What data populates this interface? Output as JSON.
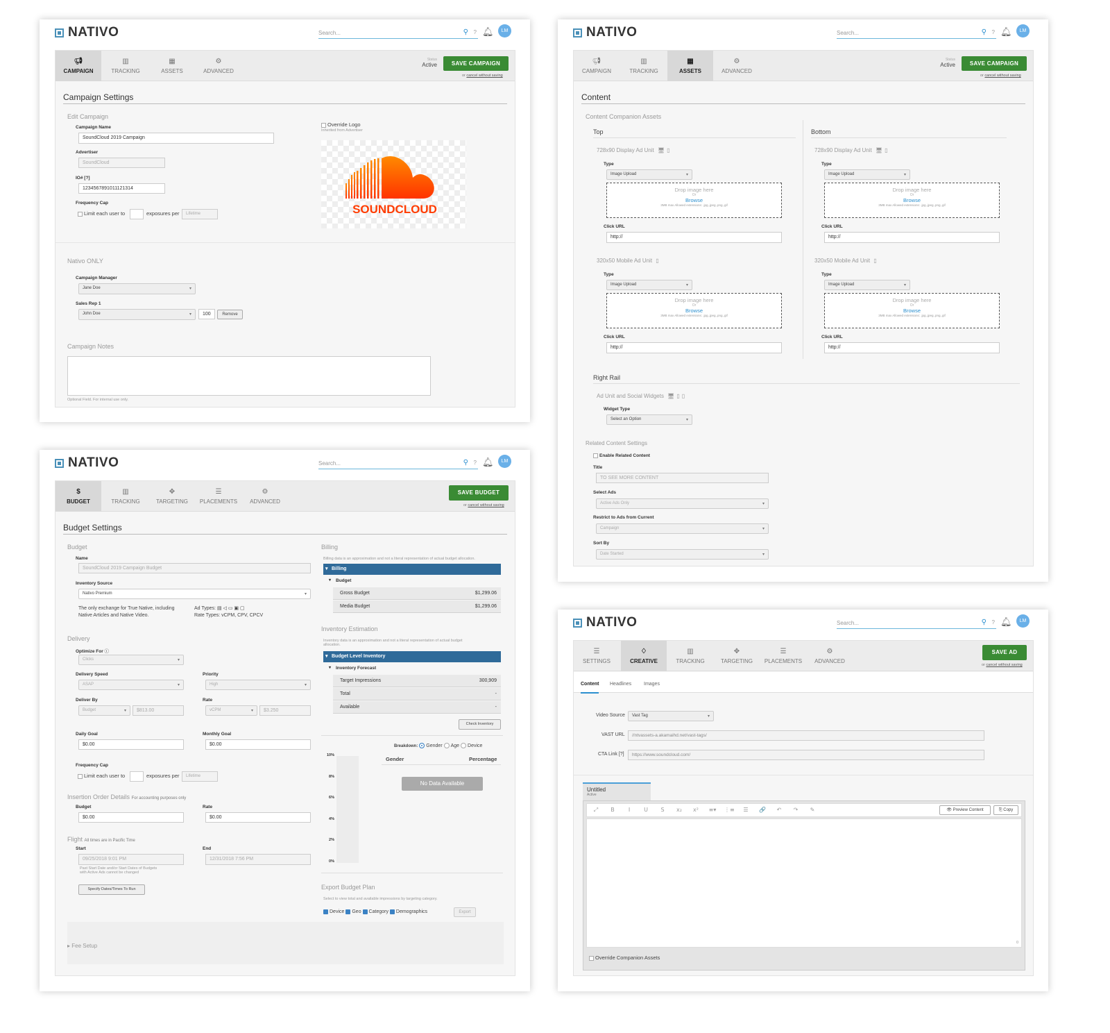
{
  "brand": {
    "logo_text": "NATIVO",
    "accent": "#3a8b34",
    "link": "#2b8fcf",
    "dark_blue": "#2f6a99"
  },
  "header": {
    "search_placeholder": "Search...",
    "search_icon": "search-icon",
    "help_icon": "help-icon",
    "bell_icon": "bell-icon",
    "avatar_initials": "LM"
  },
  "status": {
    "label": "Status",
    "value": "Active"
  },
  "cancel": {
    "prefix": "or",
    "link": "cancel without saving"
  },
  "campaign": {
    "tabs": [
      {
        "label": "CAMPAIGN",
        "icon": "megaphone-icon"
      },
      {
        "label": "TRACKING",
        "icon": "bar-chart-icon"
      },
      {
        "label": "ASSETS",
        "icon": "grid-icon"
      },
      {
        "label": "ADVANCED",
        "icon": "gear-icon"
      }
    ],
    "save_label": "SAVE CAMPAIGN",
    "title": "Campaign Settings",
    "edit_heading": "Edit Campaign",
    "name_label": "Campaign Name",
    "name_value": "SoundCloud 2019 Campaign",
    "advertiser_label": "Advertiser",
    "advertiser_value": "SoundCloud",
    "io_label": "IO# [?]",
    "io_value": "1234567891011121314",
    "freq_label": "Frequency Cap",
    "freq_text1": "Limit each user to",
    "freq_text2": "exposures per",
    "freq_period": "Lifetime",
    "override_logo": "Override Logo",
    "inherited": "Inherited from Advertiser",
    "logo_word": "SOUNDCLOUD",
    "nativo_heading": "Nativo ONLY",
    "manager_label": "Campaign Manager",
    "manager_value": "Jane Doe",
    "salesrep_label": "Sales Rep 1",
    "salesrep_value": "John Doe",
    "salesrep_pct": "100",
    "remove_label": "Remove",
    "notes_heading": "Campaign Notes",
    "notes_hint": "Optional Field. For internal use only."
  },
  "assets": {
    "tabs": [
      {
        "label": "CAMPAIGN",
        "icon": "megaphone-icon"
      },
      {
        "label": "TRACKING",
        "icon": "bar-chart-icon"
      },
      {
        "label": "ASSETS",
        "icon": "grid-icon"
      },
      {
        "label": "ADVANCED",
        "icon": "gear-icon"
      }
    ],
    "save_label": "SAVE CAMPAIGN",
    "title": "Content",
    "companion_heading": "Content Companion Assets",
    "top": "Top",
    "bottom": "Bottom",
    "display_unit": "728x90 Display Ad Unit",
    "mobile_unit": "320x50 Mobile Ad Unit",
    "type_label": "Type",
    "type_value": "Image Upload",
    "drop_text": "Drop image here",
    "or": "Or",
    "browse": "Browse",
    "allowed": "3MB max Allowed extensions: .jpg,.jpeg,.png,.gif",
    "click_url_label": "Click URL",
    "click_url_value": "http://",
    "right_rail": "Right Rail",
    "widgets_heading": "Ad Unit and Social Widgets",
    "widget_type_label": "Widget Type",
    "widget_type_value": "Select an Option",
    "related_heading": "Related Content Settings",
    "enable_related": "Enable Related Content",
    "title_label": "Title",
    "title_value": "TO SEE MORE CONTENT",
    "select_ads_label": "Select Ads",
    "select_ads_value": "Active Ads Only",
    "restrict_label": "Restrict to Ads from Current",
    "restrict_value": "Campaign",
    "sort_label": "Sort By",
    "sort_value": "Date Started"
  },
  "budget": {
    "tabs": [
      {
        "label": "BUDGET",
        "icon": "dollar-icon"
      },
      {
        "label": "TRACKING",
        "icon": "bar-chart-icon"
      },
      {
        "label": "TARGETING",
        "icon": "crosshair-icon"
      },
      {
        "label": "PLACEMENTS",
        "icon": "list-icon"
      },
      {
        "label": "ADVANCED",
        "icon": "gear-icon"
      }
    ],
    "save_label": "SAVE BUDGET",
    "title": "Budget Settings",
    "budget_heading": "Budget",
    "name_label": "Name",
    "name_value": "SoundCloud 2019 Campaign Budget",
    "source_label": "Inventory Source",
    "source_value": "Nativo Premium",
    "source_desc1": "The only exchange for True Native, including",
    "source_desc2": "Native Articles and Native Video.",
    "ad_types_label": "Ad Types:",
    "rate_types": "Rate Types: vCPM, CPV, CPCV",
    "delivery_heading": "Delivery",
    "optimize_label": "Optimize For",
    "optimize_value": "Clicks",
    "speed_label": "Delivery Speed",
    "speed_value": "ASAP",
    "priority_label": "Priority",
    "priority_value": "High",
    "deliver_by_label": "Deliver By",
    "deliver_by_value": "Budget",
    "deliver_by_amount": "$813.00",
    "rate_label": "Rate",
    "rate_type": "vCPM",
    "rate_amount": "$3.250",
    "daily_label": "Daily Goal",
    "daily_value": "$0.00",
    "monthly_label": "Monthly Goal",
    "monthly_value": "$0.00",
    "freq_label": "Frequency Cap",
    "freq_text1": "Limit each user to",
    "freq_text2": "exposures per",
    "freq_period": "Lifetime",
    "io_heading": "Insertion Order Details",
    "io_note": "For accounting purposes only",
    "io_budget_label": "Budget",
    "io_budget_value": "$0.00",
    "io_rate_label": "Rate",
    "io_rate_value": "$0.00",
    "flight_heading": "Flight",
    "flight_note": "All times are in Pacific Time",
    "start_label": "Start",
    "start_value": "09/25/2018 9:01 PM",
    "end_label": "End",
    "end_value": "12/31/2018 7:56 PM",
    "flight_warn1": "Past Start Date and/or Start Dates of Budgets",
    "flight_warn2": "with Active Ads cannot be changed",
    "specify_btn": "Specify Dates/Times To Run",
    "fee_setup": "Fee Setup",
    "billing_heading": "Billing",
    "billing_note": "Billing data is an approximation and not a literal representation of actual budget allocation.",
    "billing_bar": "Billing",
    "budget_sub": "Budget",
    "gross_label": "Gross Budget",
    "gross_value": "$1,299.06",
    "media_label": "Media Budget",
    "media_value": "$1,299.06",
    "inv_heading": "Inventory Estimation",
    "inv_note1": "Inventory data is an approximation and not a literal representation of actual budget",
    "inv_note2": "allocation.",
    "inv_bar": "Budget Level Inventory",
    "forecast_sub": "Inventory Forecast",
    "target_label": "Target Impressions",
    "target_value": "300,909",
    "total_label": "Total",
    "total_value": "-",
    "avail_label": "Available",
    "avail_value": "-",
    "check_btn": "Check Inventory",
    "breakdown_label": "Breakdown:",
    "bd_gender": "Gender",
    "bd_age": "Age",
    "bd_device": "Device",
    "col_gender": "Gender",
    "col_pct": "Percentage",
    "no_data": "No Data Available",
    "y_ticks": [
      "10%",
      "8%",
      "6%",
      "4%",
      "2%",
      "0%"
    ],
    "export_heading": "Export Budget Plan",
    "export_note": "Select to view total and available impressions by targeting category.",
    "export_opts": [
      "Device",
      "Geo",
      "Category",
      "Demographics"
    ],
    "export_btn": "Export"
  },
  "creative": {
    "tabs": [
      {
        "label": "SETTINGS",
        "icon": "list-icon"
      },
      {
        "label": "CREATIVE",
        "icon": "bulb-icon"
      },
      {
        "label": "TRACKING",
        "icon": "bar-chart-icon"
      },
      {
        "label": "TARGETING",
        "icon": "crosshair-icon"
      },
      {
        "label": "PLACEMENTS",
        "icon": "list-icon"
      },
      {
        "label": "ADVANCED",
        "icon": "gear-icon"
      }
    ],
    "save_label": "SAVE AD",
    "subtabs": [
      "Content",
      "Headlines",
      "Images"
    ],
    "video_label": "Video Source",
    "video_value": "Vast Tag",
    "vast_label": "VAST URL",
    "vast_value": "//ntvassets-a.akamaihd.net/vast-tags/",
    "cta_label": "CTA Link [?]",
    "cta_value": "https://www.soundcloud.com/",
    "doc_title": "Untitled",
    "doc_status": "Active",
    "preview_btn": "Preview Content",
    "copy_btn": "Copy",
    "toolbar": [
      "⤢",
      "B",
      "I",
      "U",
      "S",
      "x₂",
      "x²",
      "≡▾",
      "⋮≡",
      "☰",
      "🔗",
      "↶",
      "↷",
      "✎"
    ],
    "char_count": "0",
    "override": "Override Companion Assets"
  }
}
